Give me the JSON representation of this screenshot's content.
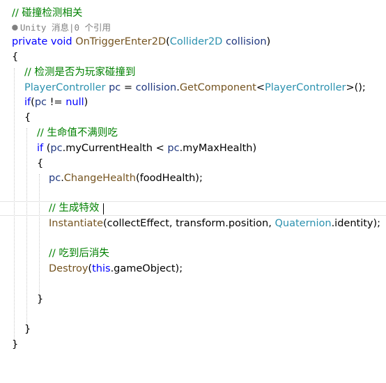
{
  "code": {
    "comment_header": "// 碰撞检测相关",
    "codelens": {
      "icon": "unity-icon",
      "text": "Unity 消息|0 个引用"
    },
    "sig": {
      "private": "private",
      "void": "void",
      "method": "OnTriggerEnter2D",
      "open": "(",
      "param_type": "Collider2D",
      "param_name": "collision",
      "close": ")"
    },
    "brace_open": "{",
    "comment_check": "// 检测是否为玩家碰撞到",
    "getcomp": {
      "type": "PlayerController",
      "var": "pc",
      "eq": " = ",
      "coll": "collision",
      "dot": ".",
      "method": "GetComponent",
      "lt": "<",
      "gtype": "PlayerController",
      "tail": ">();"
    },
    "if_null": {
      "kw": "if",
      "open": "(",
      "var": "pc",
      "op": " != ",
      "null": "null",
      "close": ")"
    },
    "brace2_open": "{",
    "comment_health": "// 生命值不满则吃",
    "if_health": {
      "kw": "if",
      "open": " (",
      "pc1": "pc",
      "field1": ".myCurrentHealth",
      "op": " < ",
      "pc2": "pc",
      "field2": ".myMaxHealth",
      "close": ")"
    },
    "brace3_open": "{",
    "change": {
      "pc": "pc",
      "dot": ".",
      "method": "ChangeHealth",
      "open": "(",
      "arg": "foodHealth",
      "close": ");"
    },
    "comment_effect": "// 生成特效",
    "inst": {
      "method": "Instantiate",
      "open": "(",
      "arg1": "collectEffect",
      "comma1": ", ",
      "arg2": "transform",
      "dot1": ".",
      "arg2b": "position",
      "comma2": ", ",
      "quat": "Quaternion",
      "dot2": ".",
      "ident": "identity",
      "close": ");"
    },
    "comment_destroy": "// 吃到后消失",
    "destroy": {
      "method": "Destroy",
      "open": "(",
      "this": "this",
      "dot": ".",
      "go": "gameObject",
      "close": ");"
    },
    "brace3_close": "}",
    "brace2_close": "}",
    "brace_close": "}"
  }
}
